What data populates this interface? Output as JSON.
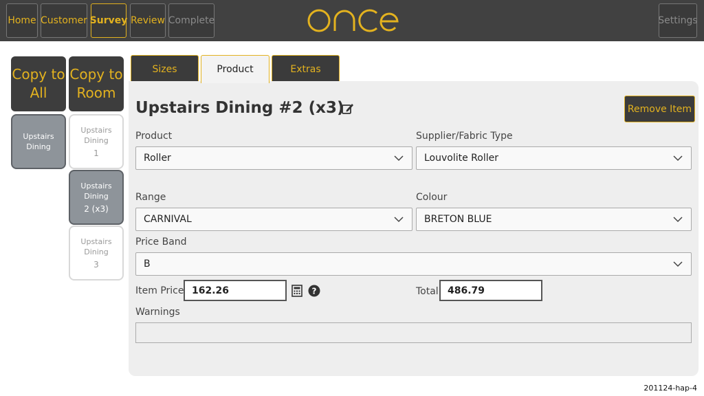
{
  "nav": {
    "home": "Home",
    "customer": "Customer",
    "survey": "Survey",
    "review": "Review",
    "complete": "Complete",
    "settings": "Settings"
  },
  "brand": {
    "logo_text": "once",
    "accent_color": "#e3b21f"
  },
  "sidebar": {
    "copy_all": "Copy to All",
    "copy_room": "Copy to Room",
    "rooms": [
      {
        "line1": "Upstairs",
        "line2": "Dining",
        "num": "",
        "state": "selected"
      },
      {
        "line1": "Upstairs",
        "line2": "Dining",
        "num": "1",
        "state": "plain"
      },
      {
        "line1": "Upstairs",
        "line2": "Dining",
        "num": "2 (x3)",
        "state": "selected"
      },
      {
        "line1": "Upstairs",
        "line2": "Dining",
        "num": "3",
        "state": "plain"
      }
    ]
  },
  "tabs": {
    "sizes": "Sizes",
    "product": "Product",
    "extras": "Extras",
    "active": "Product"
  },
  "item": {
    "title": "Upstairs Dining #2 (x3)",
    "remove_label": "Remove Item"
  },
  "form": {
    "product_label": "Product",
    "product_value": "Roller",
    "supplier_label": "Supplier/Fabric Type",
    "supplier_value": "Louvolite Roller",
    "range_label": "Range",
    "range_value": "CARNIVAL",
    "colour_label": "Colour",
    "colour_value": "BRETON BLUE",
    "price_band_label": "Price Band",
    "price_band_value": "B",
    "item_price_label": "Item Price",
    "item_price_value": "162.26",
    "total_label": "Total",
    "total_value": "486.79",
    "warnings_label": "Warnings",
    "warnings_value": ""
  },
  "footer": {
    "version": "201124-hap-4"
  }
}
